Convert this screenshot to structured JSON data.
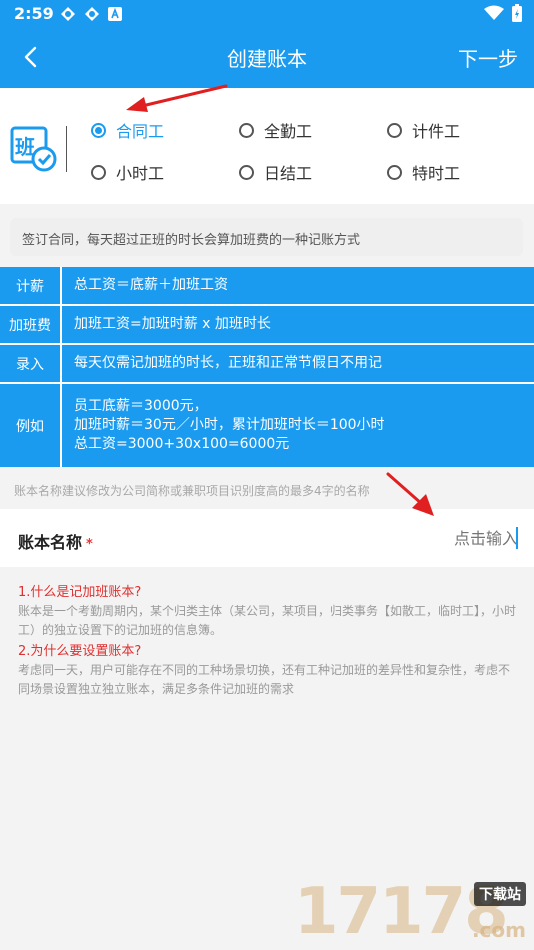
{
  "status_bar": {
    "time": "2:59"
  },
  "header": {
    "title": "创建账本",
    "next_label": "下一步"
  },
  "wage_types": {
    "selected": "合同工",
    "options": [
      "合同工",
      "全勤工",
      "计件工",
      "小时工",
      "日结工",
      "特时工"
    ]
  },
  "description": "签订合同，每天超过正班的时长会算加班费的一种记账方式",
  "rules": [
    {
      "key": "计薪",
      "lines": [
        "总工资＝底薪＋加班工资"
      ]
    },
    {
      "key": "加班费",
      "lines": [
        "加班工资=加班时薪 x 加班时长"
      ]
    },
    {
      "key": "录入",
      "lines": [
        "每天仅需记加班的时长，正班和正常节假日不用记"
      ]
    },
    {
      "key": "例如",
      "lines": [
        "员工底薪＝3000元，",
        "加班时薪＝30元／小时，累计加班时长＝100小时",
        "总工资=3000+30x100=6000元"
      ]
    }
  ],
  "name_hint": "账本名称建议修改为公司简称或兼职项目识别度高的最多4字的名称",
  "name_field": {
    "label": "账本名称",
    "required_mark": "*",
    "placeholder": "点击输入"
  },
  "faq": {
    "q1": "1.什么是记加班账本?",
    "a1": "账本是一个考勤周期内，某个归类主体（某公司，某项目，归类事务【如散工，临时工】，小时工）的独立设置下的记加班的信息簿。",
    "q2": "2.为什么要设置账本?",
    "a2": "考虑同一天，用户可能存在不同的工种场景切换，还有工种记加班的差异性和复杂性，考虑不同场景设置独立独立账本，满足多条件记加班的需求"
  },
  "watermark": {
    "text": "17178",
    "badge": "下载站",
    "sub": ".com"
  },
  "colors": {
    "accent": "#1a9bf0",
    "question": "#e03030",
    "arrow": "#e02020"
  }
}
